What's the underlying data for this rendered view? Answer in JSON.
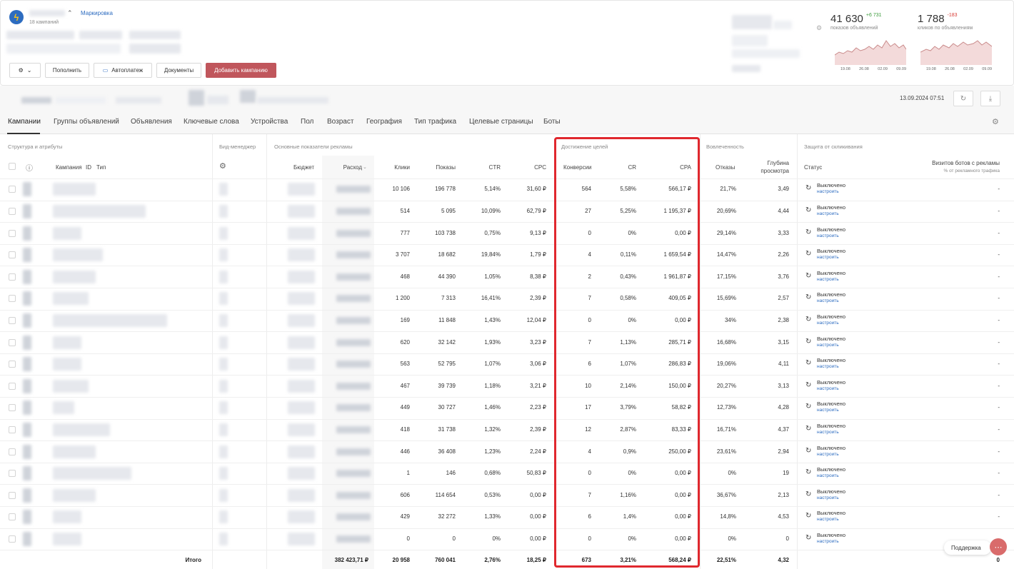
{
  "header": {
    "campaigns_count": "18 кампаний",
    "marking_link": "Маркировка",
    "buttons": {
      "replenish": "Пополнить",
      "autopay": "Автоплатеж",
      "documents": "Документы",
      "add_campaign": "Добавить кампанию"
    },
    "stats": {
      "impressions_value": "41 630",
      "impressions_delta": "+6 731",
      "impressions_label": "показов объявлений",
      "clicks_value": "1 788",
      "clicks_delta": "-183",
      "clicks_label": "кликов по объявлениям",
      "spark_dates_1": [
        "19.08",
        "26.08",
        "02.09",
        "09.09"
      ],
      "spark_dates_2": [
        "19.08",
        "26.08",
        "02.09",
        "09.09"
      ]
    },
    "accent_color": "#c0565c",
    "positive_color": "#3a9a3a",
    "negative_color": "#d9403a"
  },
  "toolbar": {
    "datetime": "13.09.2024 07:51"
  },
  "tabs": [
    "Кампании",
    "Группы объявлений",
    "Объявления",
    "Ключевые слова",
    "Устройства",
    "Пол",
    "Возраст",
    "География",
    "Тип трафика",
    "Целевые страницы",
    "Боты"
  ],
  "table": {
    "groups": {
      "structure": "Структура и атрибуты",
      "bid": "Бид-менеджер",
      "main": "Основные показатели рекламы",
      "goals": "Достижение целей",
      "engagement": "Вовлеченность",
      "protection": "Защита от скликивания"
    },
    "headers": {
      "campaign": "Кампания",
      "id": "ID",
      "type": "Тип",
      "budget": "Бюджет",
      "spend": "Расход",
      "clicks": "Клики",
      "impressions": "Показы",
      "ctr": "CTR",
      "cpc": "CPC",
      "conversions": "Конверсии",
      "cr": "CR",
      "cpa": "CPA",
      "bounces": "Отказы",
      "depth_1": "Глубина",
      "depth_2": "просмотра",
      "status": "Статус",
      "bots_1": "Визитов ботов с рекламы",
      "bots_2": "% от рекламного трафика"
    },
    "status_text": "Выключено",
    "status_link": "настроить",
    "rows": [
      {
        "clicks": "10 106",
        "impressions": "196 778",
        "ctr": "5,14%",
        "cpc": "31,60 ₽",
        "conv": "564",
        "cr": "5,58%",
        "cpa": "566,17 ₽",
        "bounce": "21,7%",
        "depth": "3,49",
        "bots": "-"
      },
      {
        "clicks": "514",
        "impressions": "5 095",
        "ctr": "10,09%",
        "cpc": "62,79 ₽",
        "conv": "27",
        "cr": "5,25%",
        "cpa": "1 195,37 ₽",
        "bounce": "20,69%",
        "depth": "4,44",
        "bots": "-"
      },
      {
        "clicks": "777",
        "impressions": "103 738",
        "ctr": "0,75%",
        "cpc": "9,13 ₽",
        "conv": "0",
        "cr": "0%",
        "cpa": "0,00 ₽",
        "bounce": "29,14%",
        "depth": "3,33",
        "bots": "-"
      },
      {
        "clicks": "3 707",
        "impressions": "18 682",
        "ctr": "19,84%",
        "cpc": "1,79 ₽",
        "conv": "4",
        "cr": "0,11%",
        "cpa": "1 659,54 ₽",
        "bounce": "14,47%",
        "depth": "2,26",
        "bots": "-"
      },
      {
        "clicks": "468",
        "impressions": "44 390",
        "ctr": "1,05%",
        "cpc": "8,38 ₽",
        "conv": "2",
        "cr": "0,43%",
        "cpa": "1 961,87 ₽",
        "bounce": "17,15%",
        "depth": "3,76",
        "bots": "-"
      },
      {
        "clicks": "1 200",
        "impressions": "7 313",
        "ctr": "16,41%",
        "cpc": "2,39 ₽",
        "conv": "7",
        "cr": "0,58%",
        "cpa": "409,05 ₽",
        "bounce": "15,69%",
        "depth": "2,57",
        "bots": "-"
      },
      {
        "clicks": "169",
        "impressions": "11 848",
        "ctr": "1,43%",
        "cpc": "12,04 ₽",
        "conv": "0",
        "cr": "0%",
        "cpa": "0,00 ₽",
        "bounce": "34%",
        "depth": "2,38",
        "bots": "-"
      },
      {
        "clicks": "620",
        "impressions": "32 142",
        "ctr": "1,93%",
        "cpc": "3,23 ₽",
        "conv": "7",
        "cr": "1,13%",
        "cpa": "285,71 ₽",
        "bounce": "16,68%",
        "depth": "3,15",
        "bots": "-"
      },
      {
        "clicks": "563",
        "impressions": "52 795",
        "ctr": "1,07%",
        "cpc": "3,06 ₽",
        "conv": "6",
        "cr": "1,07%",
        "cpa": "286,83 ₽",
        "bounce": "19,06%",
        "depth": "4,11",
        "bots": "-"
      },
      {
        "clicks": "467",
        "impressions": "39 739",
        "ctr": "1,18%",
        "cpc": "3,21 ₽",
        "conv": "10",
        "cr": "2,14%",
        "cpa": "150,00 ₽",
        "bounce": "20,27%",
        "depth": "3,13",
        "bots": "-"
      },
      {
        "clicks": "449",
        "impressions": "30 727",
        "ctr": "1,46%",
        "cpc": "2,23 ₽",
        "conv": "17",
        "cr": "3,79%",
        "cpa": "58,82 ₽",
        "bounce": "12,73%",
        "depth": "4,28",
        "bots": "-"
      },
      {
        "clicks": "418",
        "impressions": "31 738",
        "ctr": "1,32%",
        "cpc": "2,39 ₽",
        "conv": "12",
        "cr": "2,87%",
        "cpa": "83,33 ₽",
        "bounce": "16,71%",
        "depth": "4,37",
        "bots": "-"
      },
      {
        "clicks": "446",
        "impressions": "36 408",
        "ctr": "1,23%",
        "cpc": "2,24 ₽",
        "conv": "4",
        "cr": "0,9%",
        "cpa": "250,00 ₽",
        "bounce": "23,61%",
        "depth": "2,94",
        "bots": "-"
      },
      {
        "clicks": "1",
        "impressions": "146",
        "ctr": "0,68%",
        "cpc": "50,83 ₽",
        "conv": "0",
        "cr": "0%",
        "cpa": "0,00 ₽",
        "bounce": "0%",
        "depth": "19",
        "bots": "-"
      },
      {
        "clicks": "606",
        "impressions": "114 654",
        "ctr": "0,53%",
        "cpc": "0,00 ₽",
        "conv": "7",
        "cr": "1,16%",
        "cpa": "0,00 ₽",
        "bounce": "36,67%",
        "depth": "2,13",
        "bots": "-"
      },
      {
        "clicks": "429",
        "impressions": "32 272",
        "ctr": "1,33%",
        "cpc": "0,00 ₽",
        "conv": "6",
        "cr": "1,4%",
        "cpa": "0,00 ₽",
        "bounce": "14,8%",
        "depth": "4,53",
        "bots": "-"
      },
      {
        "clicks": "0",
        "impressions": "0",
        "ctr": "0%",
        "cpc": "0,00 ₽",
        "conv": "0",
        "cr": "0%",
        "cpa": "0,00 ₽",
        "bounce": "0%",
        "depth": "0",
        "bots": "-"
      }
    ],
    "totals": {
      "label": "Итого",
      "spend": "382 423,71 ₽",
      "clicks": "20 958",
      "impressions": "760 041",
      "ctr": "2,76%",
      "cpc": "18,25 ₽",
      "conv": "673",
      "cr": "3,21%",
      "cpa": "568,24 ₽",
      "bounce": "22,51%",
      "depth": "4,32",
      "bots": "0"
    }
  },
  "support": {
    "label": "Поддержка",
    "fab": "⋯"
  }
}
